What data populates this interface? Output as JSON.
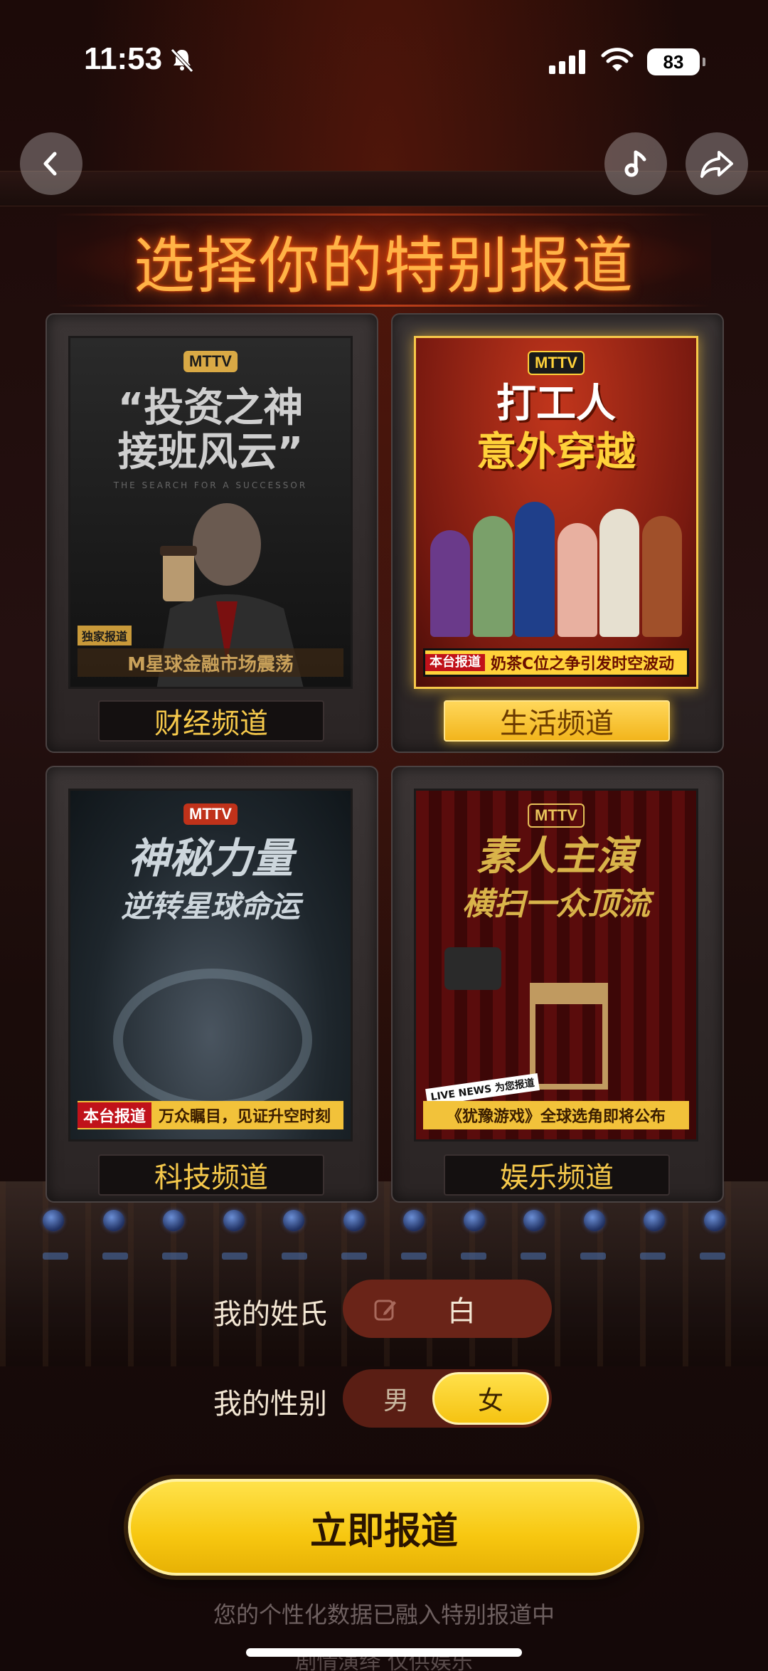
{
  "status_bar": {
    "time": "11:53",
    "battery": "83"
  },
  "page": {
    "title": "选择你的特别报道"
  },
  "channels": [
    {
      "label": "财经频道",
      "poster_logo": "MTTV",
      "poster_headline_1": "“投资之神",
      "poster_headline_2": "接班风云”",
      "poster_sub": "THE SEARCH FOR A SUCCESSOR",
      "poster_tag": "独家报道",
      "poster_ticker": "M星球金融市场震荡",
      "selected": false
    },
    {
      "label": "生活频道",
      "poster_logo": "MTTV",
      "poster_headline_1": "打工人",
      "poster_headline_2": "意外穿越",
      "poster_badge": "本台报道",
      "poster_ticker": "奶茶C位之争引发时空波动",
      "selected": true
    },
    {
      "label": "科技频道",
      "poster_logo": "MTTV",
      "poster_headline_1": "神秘力量",
      "poster_headline_2": "逆转星球命运",
      "poster_badge": "本台报道",
      "poster_ticker": "万众瞩目，见证升空时刻",
      "selected": false
    },
    {
      "label": "娱乐频道",
      "poster_logo": "MTTV",
      "poster_headline_1": "素人主演",
      "poster_headline_2": "横扫一众顶流",
      "poster_live": "LIVE NEWS 为您报道",
      "poster_ticker": "《犹豫游戏》全球选角即将公布",
      "selected": false
    }
  ],
  "form": {
    "surname_label": "我的姓氏",
    "surname_value": "白",
    "gender_label": "我的性别",
    "gender_male": "男",
    "gender_female": "女",
    "gender_selected": "女"
  },
  "actions": {
    "report_button": "立即报道"
  },
  "footer": {
    "privacy_note": "您的个性化数据已融入特别报道中",
    "disclaimer": "剧情演绎 仅供娱乐"
  },
  "colors": {
    "accent_yellow": "#f7c710",
    "title_orange": "#ffb347",
    "field_bg": "#6a2418"
  }
}
